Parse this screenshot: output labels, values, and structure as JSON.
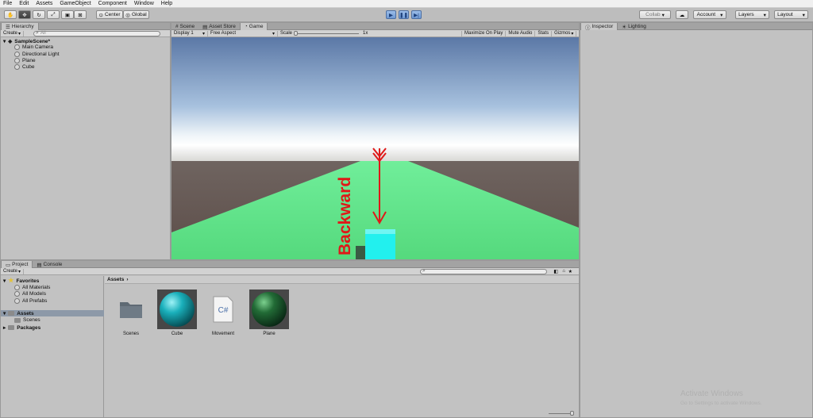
{
  "menu": [
    "File",
    "Edit",
    "Assets",
    "GameObject",
    "Component",
    "Window",
    "Help"
  ],
  "toolbar": {
    "tools": [
      "hand-tool",
      "move-tool",
      "rotate-tool",
      "scale-tool",
      "rect-tool"
    ],
    "pivot_label": "Center",
    "space_label": "Global",
    "collab_label": "Collab",
    "account_label": "Account",
    "layers_label": "Layers",
    "layout_label": "Layout"
  },
  "hierarchy": {
    "tab": "Hierarchy",
    "create_label": "Create",
    "search_placeholder": "All",
    "scene_name": "SampleScene*",
    "items": [
      "Main Camera",
      "Directional Light",
      "Plane",
      "Cube"
    ]
  },
  "center_tabs": [
    "Scene",
    "Asset Store",
    "Game"
  ],
  "game_bar": {
    "display": "Display 1",
    "aspect": "Free Aspect",
    "scale_label": "Scale",
    "scale_value": "1x",
    "options": [
      "Maximize On Play",
      "Mute Audio",
      "Stats",
      "Gizmos"
    ]
  },
  "game_view": {
    "annotation": "Backward",
    "annotation_color": "#e01818",
    "plane_color": "#5fe08c",
    "cube_color": "#22f0ee"
  },
  "inspector_tabs": [
    "Inspector",
    "Lighting"
  ],
  "bottom_tabs": [
    "Project",
    "Console"
  ],
  "project": {
    "create_label": "Create",
    "favorites_label": "Favorites",
    "favorites": [
      "All Materials",
      "All Models",
      "All Prefabs"
    ],
    "assets_label": "Assets",
    "asset_children": [
      "Scenes"
    ],
    "packages_label": "Packages",
    "breadcrumb": "Assets",
    "assets": [
      {
        "name": "Scenes",
        "kind": "folder"
      },
      {
        "name": "Cube",
        "kind": "material-cyan"
      },
      {
        "name": "Movement",
        "kind": "script"
      },
      {
        "name": "Plane",
        "kind": "material-green"
      }
    ]
  },
  "watermark": {
    "line1": "Activate Windows",
    "line2": "Go to Settings to activate Windows."
  }
}
